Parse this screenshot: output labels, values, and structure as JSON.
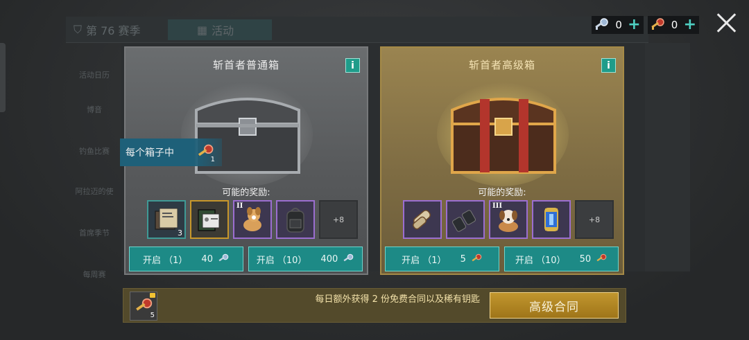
{
  "background": {
    "season_tab": "第 76 赛季",
    "activity_tab": "活动",
    "sidebar_items": [
      "活动日历",
      "博音",
      "钓鱼比赛",
      "阿拉迈的使",
      "首席季节",
      "每周赛"
    ]
  },
  "topbar": {
    "normal_key_count": "0",
    "premium_key_count": "0",
    "plus": "+",
    "normal_key_icon": "silver-key-icon",
    "premium_key_icon": "red-key-icon"
  },
  "cards": {
    "normal": {
      "title": "斩首者普通箱",
      "info": "i",
      "rewards_label": "可能的奖励:",
      "rewards": [
        {
          "icon": "documents-icon",
          "tier": "",
          "qty": "3"
        },
        {
          "icon": "id-card-icon",
          "tier": "",
          "qty": ""
        },
        {
          "icon": "puppy-icon",
          "tier": "II",
          "qty": ""
        },
        {
          "icon": "backpack-icon",
          "tier": "",
          "qty": ""
        }
      ],
      "more": "+8",
      "button1": {
        "label": "开启 （1）",
        "cost": "40"
      },
      "button2": {
        "label": "开启 （10）",
        "cost": "400"
      }
    },
    "premium": {
      "title": "斩首者高级箱",
      "info": "i",
      "rewards_label": "可能的奖励:",
      "rewards": [
        {
          "icon": "scroll-icon",
          "tier": "",
          "qty": ""
        },
        {
          "icon": "binoculars-icon",
          "tier": "",
          "qty": ""
        },
        {
          "icon": "dog-icon",
          "tier": "III",
          "qty": ""
        },
        {
          "icon": "energy-can-icon",
          "tier": "",
          "qty": ""
        }
      ],
      "more": "+8",
      "button1": {
        "label": "开启 （1）",
        "cost": "5"
      },
      "button2": {
        "label": "开启 （10）",
        "cost": "50"
      }
    }
  },
  "tooltip": {
    "text": "每个箱子中",
    "key_qty": "1"
  },
  "bottom": {
    "key_qty": "5",
    "message": "每日额外获得 2 份免费合同以及稀有钥匙",
    "button": "高级合同"
  },
  "colors": {
    "teal": "#1d8a86",
    "gold": "#c1962e",
    "premium_border": "#a58a47"
  }
}
